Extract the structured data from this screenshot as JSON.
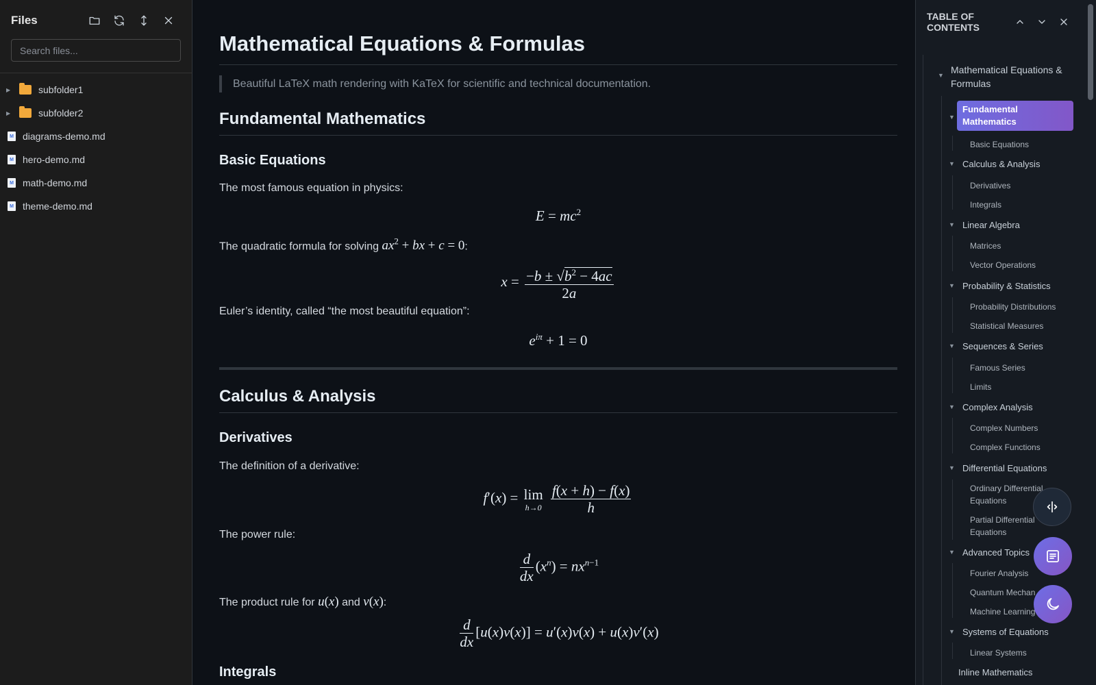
{
  "sidebar": {
    "title": "Files",
    "search_placeholder": "Search files...",
    "items": [
      {
        "type": "folder",
        "label": "subfolder1"
      },
      {
        "type": "folder",
        "label": "subfolder2"
      },
      {
        "type": "file",
        "label": "diagrams-demo.md"
      },
      {
        "type": "file",
        "label": "hero-demo.md"
      },
      {
        "type": "file",
        "label": "math-demo.md"
      },
      {
        "type": "file",
        "label": "theme-demo.md"
      }
    ],
    "icons": [
      "new-folder-icon",
      "refresh-icon",
      "collapse-icon",
      "close-icon"
    ]
  },
  "doc": {
    "title": "Mathematical Equations & Formulas",
    "quote": "Beautiful LaTeX math rendering with KaTeX for scientific and technical documentation.",
    "h2_fundamental": "Fundamental Mathematics",
    "h3_basic": "Basic Equations",
    "p_famous": "The most famous equation in physics:",
    "p_quadratic": "The quadratic formula for solving ",
    "p_euler": "Euler’s identity, called “the most beautiful equation”:",
    "h2_calculus": "Calculus & Analysis",
    "h3_derivatives": "Derivatives",
    "p_derivative_def": "The definition of a derivative:",
    "p_power_rule": "The power rule:",
    "p_product_rule_a": "The product rule for ",
    "p_product_rule_and": " and ",
    "h3_integrals": "Integrals"
  },
  "toc": {
    "title": "TABLE OF CONTENTS",
    "root": "Mathematical Equations & Formulas",
    "sections": [
      {
        "label": "Fundamental Mathematics",
        "active": true,
        "children": [
          "Basic Equations"
        ]
      },
      {
        "label": "Calculus & Analysis",
        "children": [
          "Derivatives",
          "Integrals"
        ]
      },
      {
        "label": "Linear Algebra",
        "children": [
          "Matrices",
          "Vector Operations"
        ]
      },
      {
        "label": "Probability & Statistics",
        "children": [
          "Probability Distributions",
          "Statistical Measures"
        ]
      },
      {
        "label": "Sequences & Series",
        "children": [
          "Famous Series",
          "Limits"
        ]
      },
      {
        "label": "Complex Analysis",
        "children": [
          "Complex Numbers",
          "Complex Functions"
        ]
      },
      {
        "label": "Differential Equations",
        "children": [
          "Ordinary Differential Equations",
          "Partial Differential Equations"
        ]
      },
      {
        "label": "Advanced Topics",
        "children": [
          "Fourier Analysis",
          "Quantum Mechanics",
          "Machine Learning"
        ]
      },
      {
        "label": "Systems of Equations",
        "children": [
          "Linear Systems"
        ]
      }
    ],
    "tail": "Inline Mathematics"
  },
  "colors": {
    "accent": "#7b61d6",
    "folder": "#f2a93b",
    "background": "#0d1117"
  }
}
